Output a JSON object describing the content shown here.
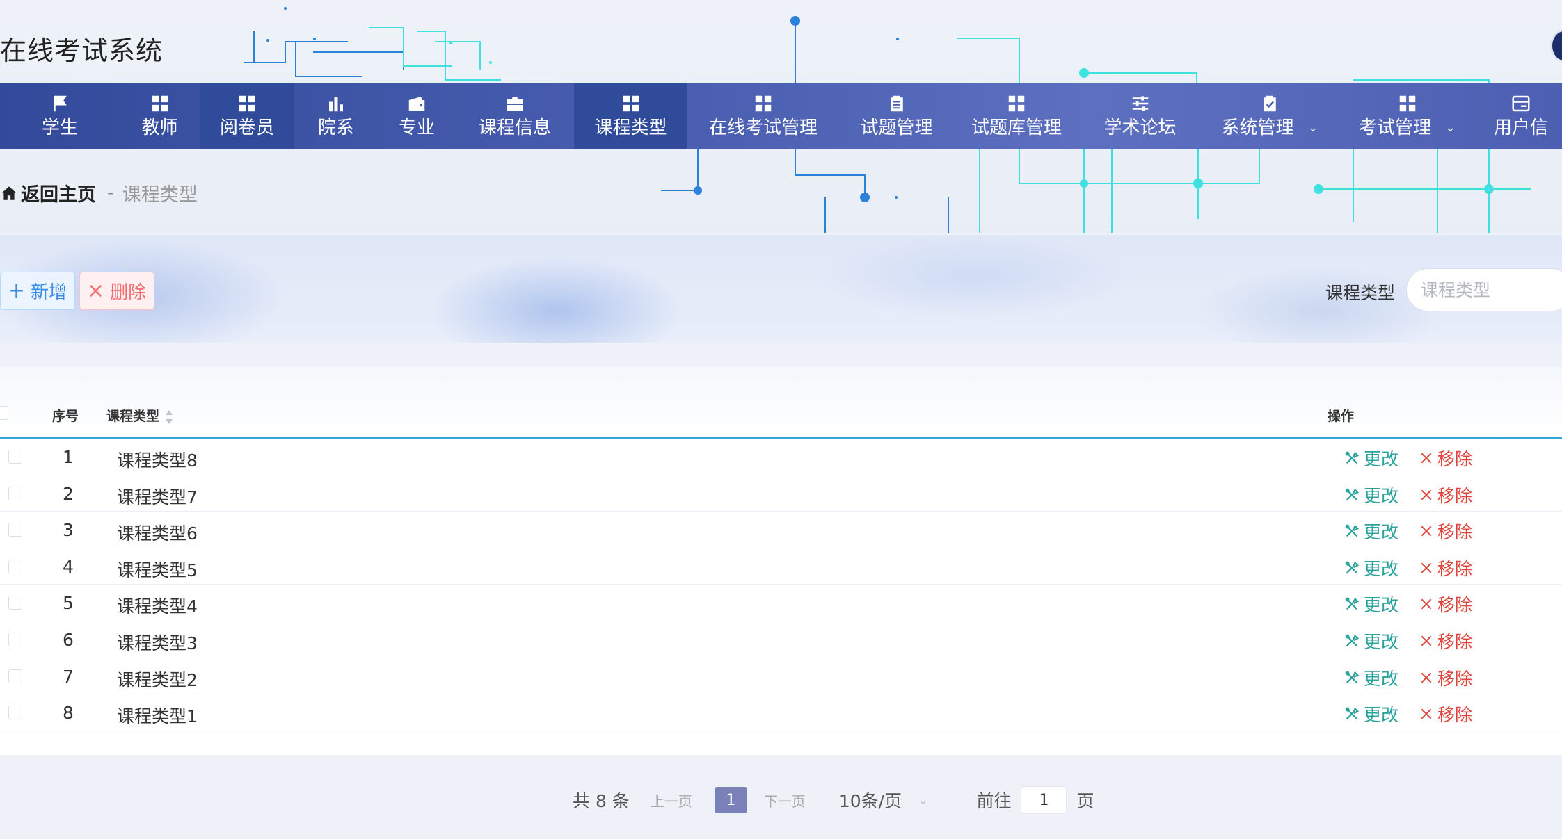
{
  "app": {
    "title": "在线考试系统"
  },
  "nav": {
    "items": [
      {
        "label": "学生",
        "icon": "flag-icon"
      },
      {
        "label": "教师",
        "icon": "grid-icon"
      },
      {
        "label": "阅卷员",
        "icon": "grid-icon",
        "active": true
      },
      {
        "label": "院系",
        "icon": "bar-chart-icon"
      },
      {
        "label": "专业",
        "icon": "wallet-icon"
      },
      {
        "label": "课程信息",
        "icon": "briefcase-icon"
      },
      {
        "label": "课程类型",
        "icon": "grid-icon",
        "active": true
      },
      {
        "label": "在线考试管理",
        "icon": "grid-icon"
      },
      {
        "label": "试题管理",
        "icon": "clipboard-icon"
      },
      {
        "label": "试题库管理",
        "icon": "grid-icon"
      },
      {
        "label": "学术论坛",
        "icon": "sliders-icon"
      },
      {
        "label": "系统管理",
        "icon": "clipboard-check-icon",
        "dropdown": true
      },
      {
        "label": "考试管理",
        "icon": "grid-icon",
        "dropdown": true
      },
      {
        "label": "用户信",
        "icon": "card-icon"
      }
    ]
  },
  "breadcrumb": {
    "home": "返回主页",
    "separator": "-",
    "current": "课程类型"
  },
  "toolbar": {
    "add_label": "新增",
    "delete_label": "删除",
    "search_label": "课程类型",
    "search_placeholder": "课程类型"
  },
  "table": {
    "headers": {
      "index": "序号",
      "name": "课程类型",
      "actions": "操作"
    },
    "rows": [
      {
        "index": "1",
        "name": "课程类型8"
      },
      {
        "index": "2",
        "name": "课程类型7"
      },
      {
        "index": "3",
        "name": "课程类型6"
      },
      {
        "index": "4",
        "name": "课程类型5"
      },
      {
        "index": "5",
        "name": "课程类型4"
      },
      {
        "index": "6",
        "name": "课程类型3"
      },
      {
        "index": "7",
        "name": "课程类型2"
      },
      {
        "index": "8",
        "name": "课程类型1"
      }
    ],
    "edit_label": "更改",
    "remove_label": "移除"
  },
  "pagination": {
    "total": "共 8 条",
    "prev": "上一页",
    "current_page": "1",
    "next": "下一页",
    "page_size": "10条/页",
    "goto_label": "前往",
    "goto_value": "1",
    "page_suffix": "页"
  },
  "colors": {
    "nav_bg": "#4a5fb1",
    "nav_active": "#2f4b99",
    "accent": "#35a6d9",
    "edit": "#2ba39c",
    "remove": "#e0443c",
    "pager_active": "#7a80b8"
  }
}
